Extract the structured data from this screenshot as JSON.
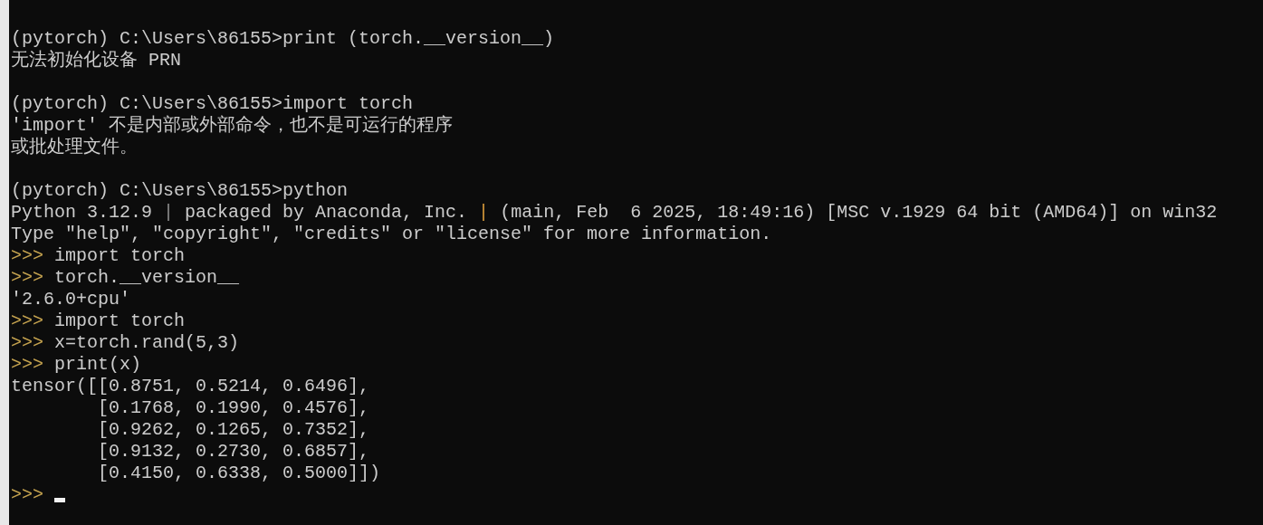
{
  "console": {
    "lines": [
      {
        "kind": "text",
        "segments": [
          {
            "kind": "plain",
            "text": "(pytorch) C:\\Users\\86155>print (torch.__version__)"
          }
        ]
      },
      {
        "kind": "text",
        "segments": [
          {
            "kind": "plain",
            "text": "无法初始化设备 PRN"
          }
        ]
      },
      {
        "kind": "blank"
      },
      {
        "kind": "text",
        "segments": [
          {
            "kind": "plain",
            "text": "(pytorch) C:\\Users\\86155>import torch"
          }
        ]
      },
      {
        "kind": "text",
        "segments": [
          {
            "kind": "plain",
            "text": "'import' 不是内部或外部命令，也不是可运行的程序"
          }
        ]
      },
      {
        "kind": "text",
        "segments": [
          {
            "kind": "plain",
            "text": "或批处理文件。"
          }
        ]
      },
      {
        "kind": "blank"
      },
      {
        "kind": "text",
        "segments": [
          {
            "kind": "plain",
            "text": "(pytorch) C:\\Users\\86155>python"
          }
        ]
      },
      {
        "kind": "text",
        "segments": [
          {
            "kind": "plain",
            "text": "Python 3.12.9 "
          },
          {
            "kind": "bar",
            "text": "|"
          },
          {
            "kind": "plain",
            "text": " packaged by Anaconda, Inc. "
          },
          {
            "kind": "accent",
            "text": "|"
          },
          {
            "kind": "plain",
            "text": " (main, Feb  6 2025, 18:49:16) [MSC v.1929 64 bit (AMD64)] on win32"
          }
        ]
      },
      {
        "kind": "text",
        "segments": [
          {
            "kind": "plain",
            "text": "Type \"help\", \"copyright\", \"credits\" or \"license\" for more information."
          }
        ]
      },
      {
        "kind": "text",
        "segments": [
          {
            "kind": "prompt",
            "text": ">>>"
          },
          {
            "kind": "plain",
            "text": " import torch"
          }
        ]
      },
      {
        "kind": "text",
        "segments": [
          {
            "kind": "prompt",
            "text": ">>>"
          },
          {
            "kind": "plain",
            "text": " torch.__version__"
          }
        ]
      },
      {
        "kind": "text",
        "segments": [
          {
            "kind": "plain",
            "text": "'2.6.0+cpu'"
          }
        ]
      },
      {
        "kind": "text",
        "segments": [
          {
            "kind": "prompt",
            "text": ">>>"
          },
          {
            "kind": "plain",
            "text": " import torch"
          }
        ]
      },
      {
        "kind": "text",
        "segments": [
          {
            "kind": "prompt",
            "text": ">>>"
          },
          {
            "kind": "plain",
            "text": " x=torch.rand(5,3)"
          }
        ]
      },
      {
        "kind": "text",
        "segments": [
          {
            "kind": "prompt",
            "text": ">>>"
          },
          {
            "kind": "plain",
            "text": " print(x)"
          }
        ]
      },
      {
        "kind": "text",
        "segments": [
          {
            "kind": "plain",
            "text": "tensor([[0.8751, 0.5214, 0.6496],"
          }
        ]
      },
      {
        "kind": "text",
        "segments": [
          {
            "kind": "plain",
            "text": "        [0.1768, 0.1990, 0.4576],"
          }
        ]
      },
      {
        "kind": "text",
        "segments": [
          {
            "kind": "plain",
            "text": "        [0.9262, 0.1265, 0.7352],"
          }
        ]
      },
      {
        "kind": "text",
        "segments": [
          {
            "kind": "plain",
            "text": "        [0.9132, 0.2730, 0.6857],"
          }
        ]
      },
      {
        "kind": "text",
        "segments": [
          {
            "kind": "plain",
            "text": "        [0.4150, 0.6338, 0.5000]])"
          }
        ]
      },
      {
        "kind": "text",
        "segments": [
          {
            "kind": "prompt",
            "text": ">>>"
          },
          {
            "kind": "cursor"
          }
        ]
      }
    ]
  }
}
